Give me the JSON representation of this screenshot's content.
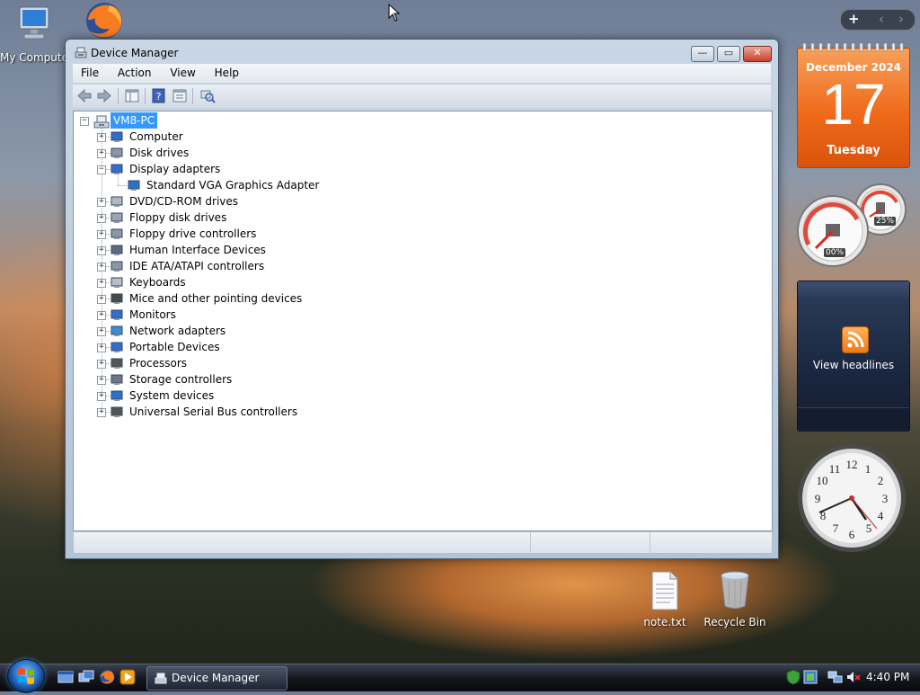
{
  "desktop": {
    "icons": [
      {
        "label": "My Compute"
      },
      {
        "label": ""
      },
      {
        "label": "note.txt"
      },
      {
        "label": "Recycle Bin"
      }
    ]
  },
  "window": {
    "title": "Device Manager",
    "controls": {
      "minimize": "—",
      "maximize": "▭",
      "close": "✕"
    },
    "menu": [
      "File",
      "Action",
      "View",
      "Help"
    ]
  },
  "tree": {
    "root": "VM8-PC",
    "items": [
      {
        "label": "Computer",
        "expanded": false
      },
      {
        "label": "Disk drives",
        "expanded": false
      },
      {
        "label": "Display adapters",
        "expanded": true,
        "children": [
          "Standard VGA Graphics Adapter"
        ]
      },
      {
        "label": "DVD/CD-ROM drives",
        "expanded": false
      },
      {
        "label": "Floppy disk drives",
        "expanded": false
      },
      {
        "label": "Floppy drive controllers",
        "expanded": false
      },
      {
        "label": "Human Interface Devices",
        "expanded": false
      },
      {
        "label": "IDE ATA/ATAPI controllers",
        "expanded": false
      },
      {
        "label": "Keyboards",
        "expanded": false
      },
      {
        "label": "Mice and other pointing devices",
        "expanded": false
      },
      {
        "label": "Monitors",
        "expanded": false
      },
      {
        "label": "Network adapters",
        "expanded": false
      },
      {
        "label": "Portable Devices",
        "expanded": false
      },
      {
        "label": "Processors",
        "expanded": false
      },
      {
        "label": "Storage controllers",
        "expanded": false
      },
      {
        "label": "System devices",
        "expanded": false
      },
      {
        "label": "Universal Serial Bus controllers",
        "expanded": false
      }
    ]
  },
  "gadgets": {
    "calendar": {
      "month_year": "December 2024",
      "day": "17",
      "weekday": "Tuesday"
    },
    "cpu_meter": {
      "cpu": "00%",
      "memory": "25%"
    },
    "feed": {
      "label": "View headlines"
    },
    "sidebar_nav": {
      "add": "+",
      "prev": "‹",
      "next": "›"
    }
  },
  "taskbar": {
    "active_window": "Device Manager",
    "clock": "4:40 PM"
  },
  "colors": {
    "selection": "#3399ff",
    "calendar_orange": "#ef6a1a",
    "window_frame": "#b3c4d7"
  }
}
